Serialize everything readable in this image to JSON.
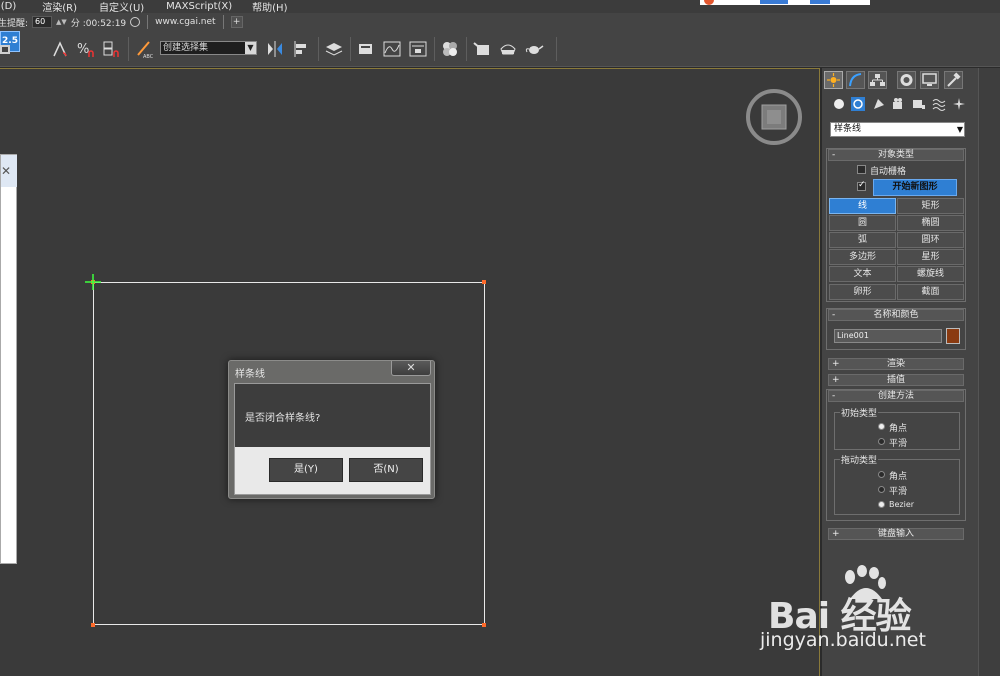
{
  "menubar": {
    "items": [
      {
        "label": "i(D)"
      },
      {
        "label": "渲染(R)"
      },
      {
        "label": "自定义(U)"
      },
      {
        "label": "MAXScript(X)"
      },
      {
        "label": "帮助(H)"
      }
    ]
  },
  "infobar": {
    "reminder_label": "生提醒:",
    "interval_value": "60",
    "minute_label": "分 :00:52:19",
    "url": "www.cgai.net",
    "plus": "+"
  },
  "toolbar": {
    "snap_label": "2.5",
    "percent_label": "%",
    "selection_set_placeholder": "创建选择集"
  },
  "dialog": {
    "title": "样条线",
    "close": "✕",
    "message": "是否闭合样条线?",
    "yes_label": "是(Y)",
    "no_label": "否(N)"
  },
  "left_panel": {
    "close": "✕"
  },
  "command_panel": {
    "category_dropdown": "样条线",
    "object_type": {
      "header": "对象类型",
      "autogrid_label": "自动栅格",
      "autogrid_checked": false,
      "start_new_shape_checked": true,
      "start_new_shape_label": "开始新图形",
      "buttons": [
        "线",
        "矩形",
        "圆",
        "椭圆",
        "弧",
        "圆环",
        "多边形",
        "星形",
        "文本",
        "螺旋线",
        "卵形",
        "截面"
      ],
      "active_button": "线"
    },
    "name_color": {
      "header": "名称和颜色",
      "name_value": "Line001",
      "color": "#8a3a10"
    },
    "rendering": {
      "header": "渲染"
    },
    "interpolation": {
      "header": "插值"
    },
    "creation_method": {
      "header": "创建方法",
      "initial_type": {
        "label": "初始类型",
        "options": [
          "角点",
          "平滑"
        ],
        "selected": "角点"
      },
      "drag_type": {
        "label": "拖动类型",
        "options": [
          "角点",
          "平滑",
          "Bezier"
        ],
        "selected": "Bezier"
      }
    },
    "keyboard_entry": {
      "header": "键盘输入"
    }
  },
  "watermark": {
    "brand": "Bai 经验",
    "url": "jingyan.baidu.net"
  },
  "colors": {
    "accent": "#2f7fd3",
    "viewport_bg": "#3a3a3a",
    "vertex": "#ff6a2a"
  }
}
